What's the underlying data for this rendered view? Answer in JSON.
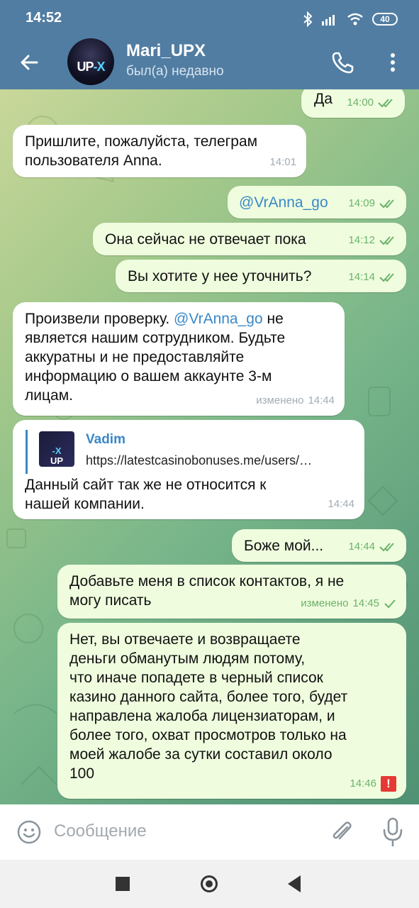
{
  "status_bar": {
    "time": "14:52",
    "battery": "40"
  },
  "header": {
    "name": "Mari_UPX",
    "status": "был(а) недавно",
    "avatar_text": "UP",
    "avatar_text_accent": "-X"
  },
  "messages": [
    {
      "dir": "out",
      "text": "Да",
      "time": "14:00",
      "ticks": "read"
    },
    {
      "dir": "in",
      "text": "Пришлите, пожалуйста, телеграм\nпользователя Anna.",
      "time": "14:01"
    },
    {
      "dir": "out",
      "text": "@VrAnna_go",
      "time": "14:09",
      "ticks": "read"
    },
    {
      "dir": "out",
      "text": "Она сейчас не отвечает пока",
      "time": "14:12",
      "ticks": "read"
    },
    {
      "dir": "out",
      "text": "Вы хотите у нее уточнить?",
      "time": "14:14",
      "ticks": "read"
    },
    {
      "dir": "in",
      "text_before": "Произвели проверку. ",
      "mention": "@VrAnna_go",
      "text_after": "  не\nявляется нашим сотрудником. Будьте\nаккуратны и не предоставляйте\nинформацию о вашем аккаунте 3-м\nлицам.",
      "edited": "изменено",
      "time": "14:44"
    },
    {
      "dir": "in",
      "quote_title": "Vadim",
      "quote_url": "https://latestcasinobonuses.me/users/…",
      "quote_thumb_text": "UP",
      "quote_thumb_accent": "-X",
      "text": "Данный сайт так  же не относится к\nнашей компании.",
      "time": "14:44"
    },
    {
      "dir": "out",
      "text": "Боже мой...",
      "time": "14:44",
      "ticks": "read"
    },
    {
      "dir": "out",
      "text": "Добавьте меня в список контактов, я не\nмогу писать",
      "edited": "изменено",
      "time": "14:45",
      "ticks": "sent"
    },
    {
      "dir": "out",
      "text": "Нет, вы отвечаете и возвращаете\nденьги обманутым людям потому,\nчто иначе попадете в черный список\nказино данного сайта, более того, будет\nнаправлена жалоба лицензиаторам, и\nболее того, охват просмотров только на\nмоей жалобе за сутки составил около\n100",
      "time": "14:46",
      "status_icon": "!"
    }
  ],
  "input": {
    "placeholder": "Сообщение"
  },
  "colors": {
    "header": "#517da2",
    "outgoing_bubble": "#effdde",
    "incoming_bubble": "#ffffff",
    "link": "#3a88c8",
    "tick": "#6cb26b",
    "error": "#e53935"
  }
}
